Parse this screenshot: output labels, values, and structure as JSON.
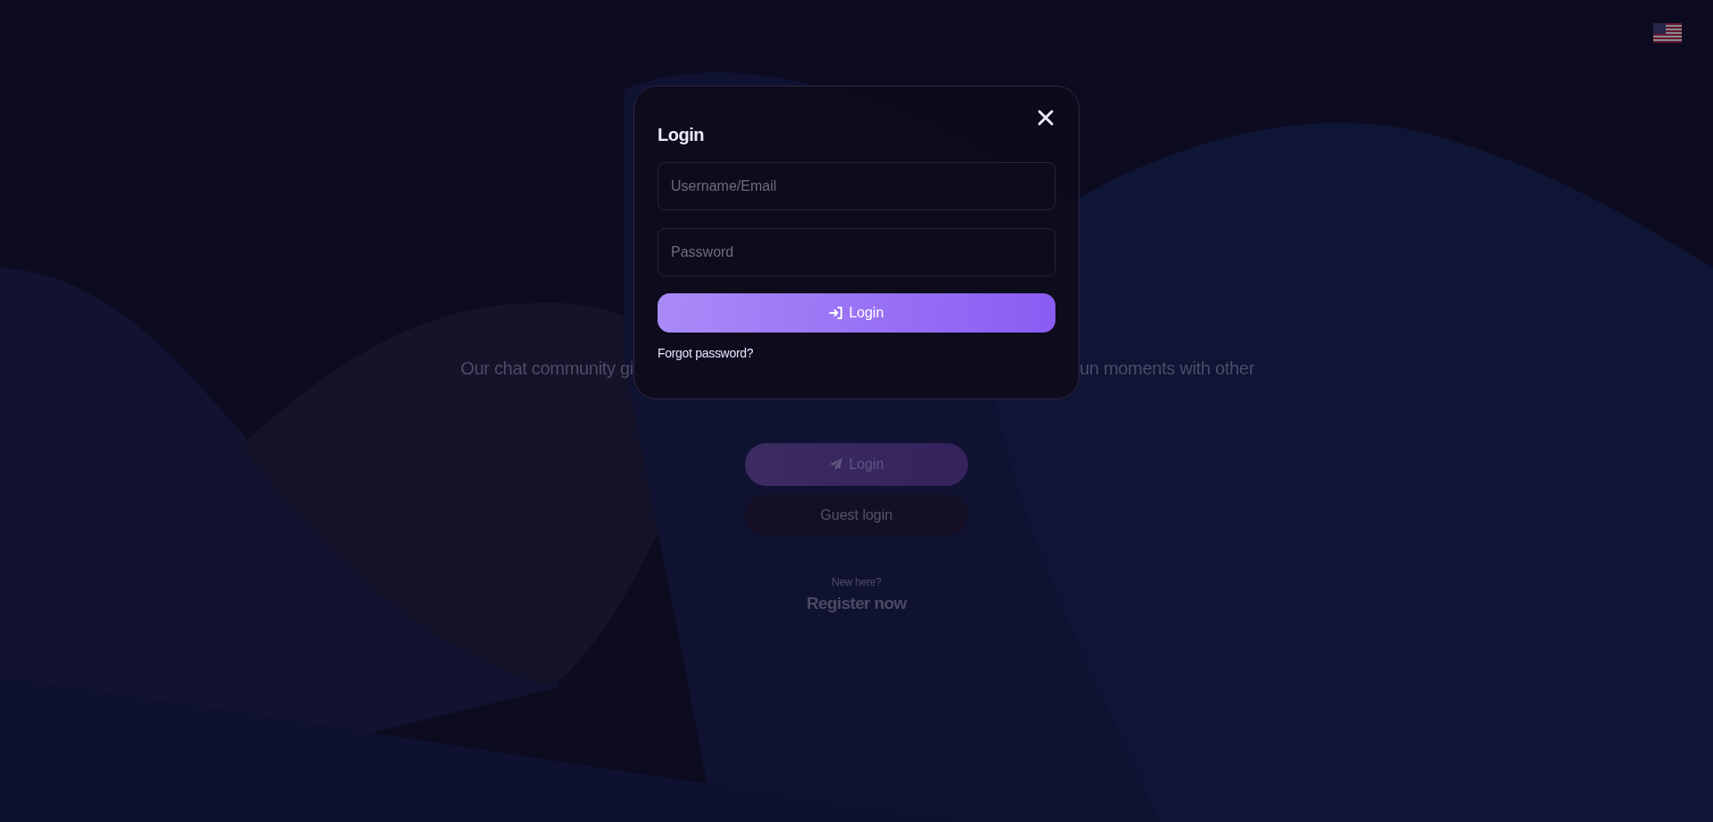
{
  "tagline": {
    "left": "Our chat community gi",
    "right": "un moments with other"
  },
  "actions": [
    {
      "kind": "primary",
      "label": "Login"
    },
    {
      "kind": "secondary",
      "label": "Guest login"
    }
  ],
  "register": {
    "prompt": "New here?",
    "link": "Register now"
  },
  "modal": {
    "title": "Login",
    "fields": [
      {
        "placeholder": "Username/Email"
      },
      {
        "placeholder": "Password"
      }
    ],
    "submit": "Login",
    "forgot": "Forgot password?"
  }
}
